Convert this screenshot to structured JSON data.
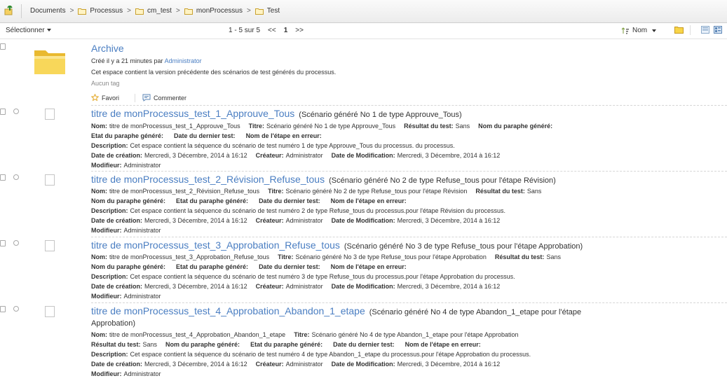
{
  "breadcrumb": [
    "Documents",
    "Processus",
    "cm_test",
    "monProcessus",
    "Test"
  ],
  "toolbar": {
    "select_label": "Sélectionner",
    "pager_range": "1 - 5 sur 5",
    "pager_prev": "<<",
    "pager_page": "1",
    "pager_next": ">>",
    "sort_label": "Nom"
  },
  "archive": {
    "title": "Archive",
    "created_prefix": "Créé il y a 21 minutes par",
    "created_by": "Administrator",
    "description": "Cet espace contient la version précédente des scénarios de test générés du processus.",
    "tags": "Aucun tag",
    "favori": "Favori",
    "commenter": "Commenter"
  },
  "labels": {
    "nom": "Nom:",
    "titre": "Titre:",
    "resultat": "Résultat du test:",
    "nom_paraphe": "Nom du paraphe généré:",
    "etat_paraphe": "Etat du paraphe généré:",
    "date_dernier": "Date du dernier test:",
    "nom_etape": "Nom de l'étape en erreur:",
    "description": "Description:",
    "date_creation": "Date de création:",
    "createur": "Créateur:",
    "date_modif": "Date de Modification:",
    "modifieur": "Modifieur:"
  },
  "items": [
    {
      "title": "titre de monProcessus_test_1_Approuve_Tous",
      "subtitle": "(Scénario généré No 1 de type Approuve_Tous)",
      "nom": "titre de monProcessus_test_1_Approuve_Tous",
      "titre": "Scénario généré No 1 de type Approuve_Tous",
      "resultat": "Sans",
      "description": "Cet espace contient la séquence du scénario de test numéro 1 de type Approuve_Tous du processus. du processus.",
      "date_creation": "Mercredi, 3 Décembre, 2014 à 16:12",
      "createur": "Administrator",
      "date_modif": "Mercredi, 3 Décembre, 2014 à 16:12",
      "modifieur": "Administrator"
    },
    {
      "title": "titre de monProcessus_test_2_Révision_Refuse_tous",
      "subtitle": "(Scénario généré No 2 de type Refuse_tous pour l'étape Révision)",
      "nom": "titre de monProcessus_test_2_Révision_Refuse_tous",
      "titre": "Scénario généré No 2 de type Refuse_tous pour l'étape Révision",
      "resultat": "Sans",
      "description": "Cet espace contient la séquence du scénario de test numéro 2 de type Refuse_tous du processus.pour l'étape Révision du processus.",
      "date_creation": "Mercredi, 3 Décembre, 2014 à 16:12",
      "createur": "Administrator",
      "date_modif": "Mercredi, 3 Décembre, 2014 à 16:12",
      "modifieur": "Administrator"
    },
    {
      "title": "titre de monProcessus_test_3_Approbation_Refuse_tous",
      "subtitle": "(Scénario généré No 3 de type Refuse_tous pour l'étape Approbation)",
      "nom": "titre de monProcessus_test_3_Approbation_Refuse_tous",
      "titre": "Scénario généré No 3 de type Refuse_tous pour l'étape Approbation",
      "resultat": "Sans",
      "description": "Cet espace contient la séquence du scénario de test numéro 3 de type Refuse_tous du processus.pour l'étape Approbation du processus.",
      "date_creation": "Mercredi, 3 Décembre, 2014 à 16:12",
      "createur": "Administrator",
      "date_modif": "Mercredi, 3 Décembre, 2014 à 16:12",
      "modifieur": "Administrator"
    },
    {
      "title": "titre de monProcessus_test_4_Approbation_Abandon_1_etape",
      "subtitle": "(Scénario généré No 4 de type Abandon_1_etape pour l'étape",
      "subtitle2": "Approbation)",
      "nom": "titre de monProcessus_test_4_Approbation_Abandon_1_etape",
      "titre": "Scénario généré No 4 de type Abandon_1_etape pour l'étape Approbation",
      "resultat": "Sans",
      "description": "Cet espace contient la séquence du scénario de test numéro 4 de type Abandon_1_etape du processus.pour l'étape Approbation du processus.",
      "date_creation": "Mercredi, 3 Décembre, 2014 à 16:12",
      "createur": "Administrator",
      "date_modif": "Mercredi, 3 Décembre, 2014 à 16:12",
      "modifieur": "Administrator"
    }
  ],
  "colors": {
    "link": "#4a7ec2",
    "folder": "#f5c842"
  }
}
